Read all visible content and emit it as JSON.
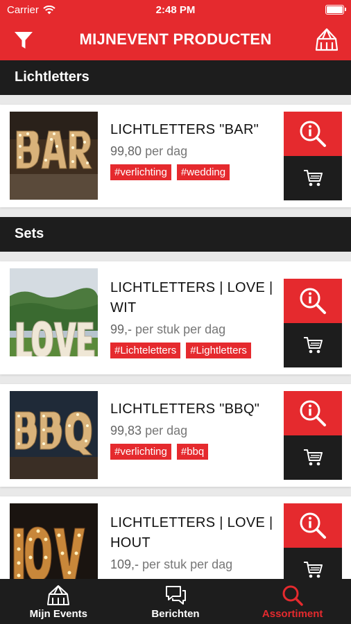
{
  "status_bar": {
    "carrier": "Carrier",
    "time": "2:48 PM"
  },
  "header": {
    "title": "MIJNEVENT PRODUCTEN"
  },
  "sections": [
    {
      "title": "Lichtletters",
      "products": [
        {
          "name": "LICHTLETTERS \"BAR\"",
          "price": "99,80",
          "unit": "per dag",
          "tags": [
            "#verlichting",
            "#wedding"
          ]
        }
      ]
    },
    {
      "title": "Sets",
      "products": [
        {
          "name": "LICHTLETTERS | LOVE | WIT",
          "price": "99,-",
          "unit": "per stuk per dag",
          "tags": [
            "#Lichteletters",
            "#Lightletters"
          ]
        },
        {
          "name": "LICHTLETTERS \"BBQ\"",
          "price": "99,83",
          "unit": "per dag",
          "tags": [
            "#verlichting",
            "#bbq"
          ]
        },
        {
          "name": "LICHTLETTERS | LOVE | HOUT",
          "price": "109,-",
          "unit": "per stuk per dag",
          "tags": []
        }
      ]
    }
  ],
  "tabs": [
    {
      "label": "Mijn Events",
      "icon": "tent-icon",
      "active": false
    },
    {
      "label": "Berichten",
      "icon": "chat-icon",
      "active": false
    },
    {
      "label": "Assortiment",
      "icon": "search-icon",
      "active": true
    }
  ],
  "colors": {
    "brand_red": "#e52a2e",
    "dark": "#1d1d1d"
  }
}
